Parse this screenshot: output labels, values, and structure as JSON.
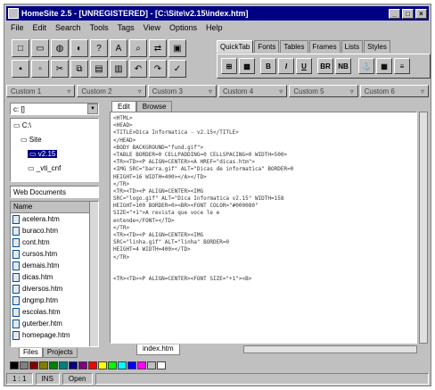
{
  "window": {
    "title": "HomeSite 2.5 - [UNREGISTERED] - [C:\\Site\\v2.15\\index.htm]"
  },
  "menu": [
    "File",
    "Edit",
    "Search",
    "Tools",
    "Tags",
    "View",
    "Options",
    "Help"
  ],
  "toolbar_icons": [
    "new-file-icon",
    "open-folder-icon",
    "globe-icon",
    "browse-icon",
    "help-icon",
    "text-icon",
    "find-icon",
    "replace-icon",
    "image-icon",
    "save-icon",
    "save-all-icon",
    "cut-icon",
    "copy-icon",
    "paste-icon",
    "print-icon",
    "undo-icon",
    "redo-icon",
    "spell-icon"
  ],
  "tag_tabs": [
    "QuickTab",
    "Fonts",
    "Tables",
    "Frames",
    "Lists",
    "Styles"
  ],
  "tag_buttons": [
    "body-icon",
    "image-tag-icon",
    "B",
    "I",
    "U",
    "BR",
    "NB",
    "anchor-icon",
    "table-icon",
    "list-icon"
  ],
  "custom_buttons": [
    "Custom 1",
    "Custom 2",
    "Custom 3",
    "Custom 4",
    "Custom 5",
    "Custom 6"
  ],
  "drive": "c: []",
  "folders": [
    {
      "label": "C:\\",
      "level": 0
    },
    {
      "label": "Site",
      "level": 1
    },
    {
      "label": "v2.15",
      "level": 2,
      "selected": true
    },
    {
      "label": "_vti_cnf",
      "level": 2
    }
  ],
  "filter": "Web Documents",
  "filelist_header": "Name",
  "files": [
    "acelera.htm",
    "buraco.htm",
    "cont.htm",
    "cursos.htm",
    "demais.htm",
    "dicas.htm",
    "diversos.htm",
    "dngmp.htm",
    "escolas.htm",
    "guterber.htm",
    "homepage.htm"
  ],
  "left_tabs": [
    "Files",
    "Projects"
  ],
  "editor_tabs": [
    "Edit",
    "Browse"
  ],
  "code_lines": [
    "<HTML>",
    "<HEAD>",
    "<TITLE>Dica Informatica - v2.15</TITLE>",
    "</HEAD>",
    "<BODY BACKGROUND=\"fund.gif\">",
    "<TABLE BORDER=0 CELLPADDING=0 CELLSPACING=0 WIDTH=500>",
    "<TR><TD><P ALIGN=CENTER><A HREF=\"dicas.htm\">",
    "<IMG SRC=\"barra.gif\" ALT=\"Dicas de informatica\" BORDER=0",
    "HEIGHT=16 WIDTH=400></A></TD>",
    "</TR>",
    "<TR><TD><P ALIGN=CENTER><IMG",
    "SRC=\"logo.gif\" ALT=\"Dica Informatica v2.15\" WIDTH=158",
    "HEIGHT=100 BORDER=0><BR><FONT COLOR=\"#000080\"",
    "SIZE=\"+1\">A revista que voce le e",
    "entende</FONT></TD>",
    "</TR>",
    "<TR><TD><P ALIGN=CENTER><IMG",
    "SRC=\"linha.gif\" ALT=\"linha\" BORDER=0",
    "HEIGHT=4 WIDTH=400></TD>",
    "</TR>",
    "",
    "",
    "<TR><TD><P ALIGN=CENTER><FONT SIZE=\"+1\"><B>"
  ],
  "doc_tab": "index.htm",
  "palette_colors": [
    "#000000",
    "#808080",
    "#800000",
    "#808000",
    "#008000",
    "#008080",
    "#000080",
    "#800080",
    "#ff0000",
    "#ffff00",
    "#00ff00",
    "#00ffff",
    "#0000ff",
    "#ff00ff",
    "#c0c0c0",
    "#ffffff"
  ],
  "status": {
    "position": "1 : 1",
    "mode": "INS",
    "state": "Open"
  }
}
